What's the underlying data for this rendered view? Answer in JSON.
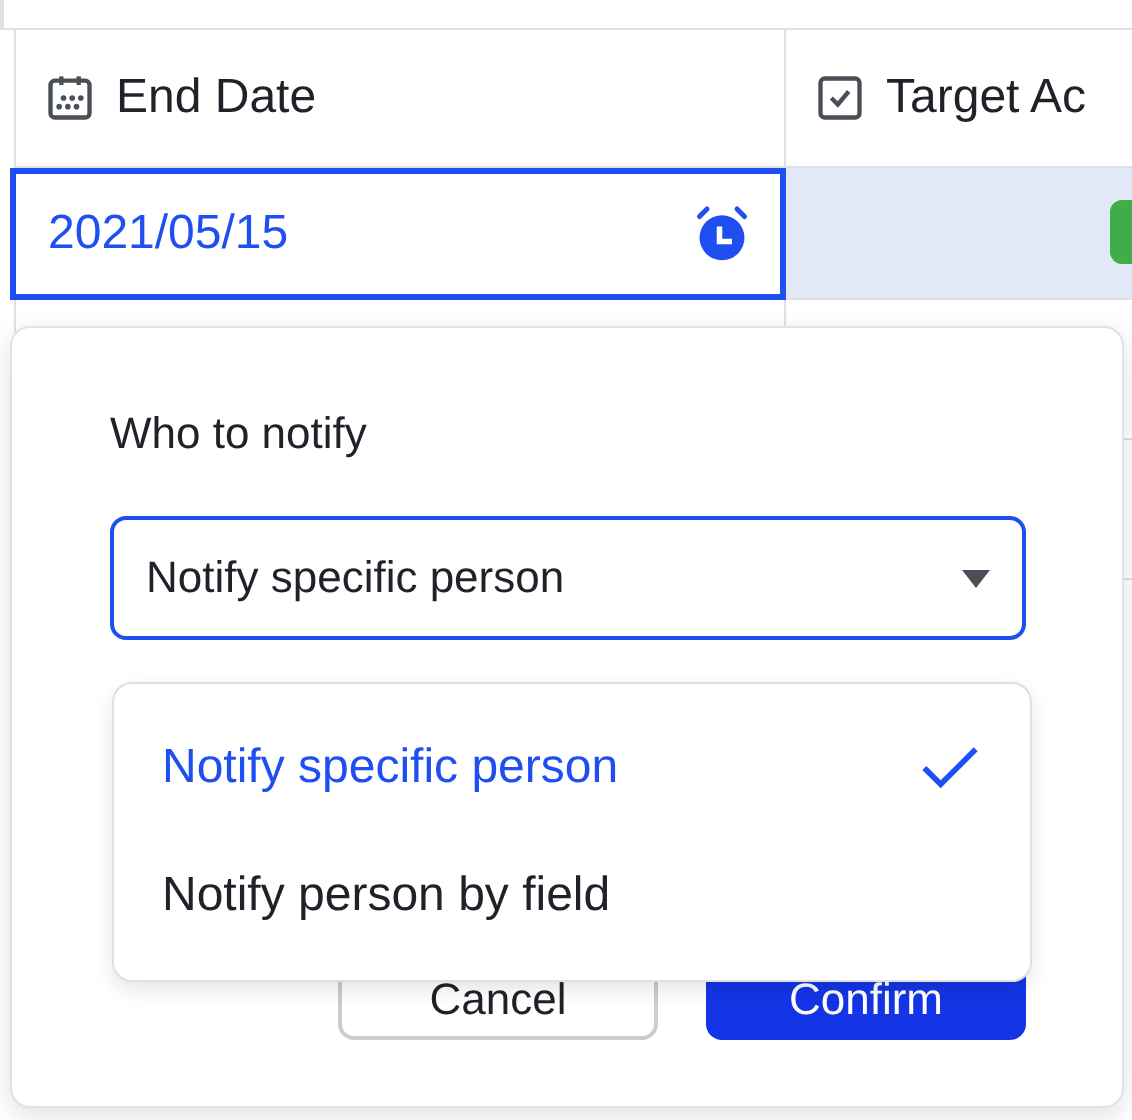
{
  "table": {
    "columns": [
      {
        "label": "End Date",
        "kind": "date"
      },
      {
        "label": "Target Ac",
        "kind": "checkbox"
      }
    ],
    "active_cell": {
      "value": "2021/05/15",
      "reminder": true
    }
  },
  "popup": {
    "label": "Who to notify",
    "select": {
      "value": "Notify specific person",
      "open": true
    },
    "options": [
      {
        "label": "Notify specific person",
        "selected": true
      },
      {
        "label": "Notify person by field",
        "selected": false
      }
    ],
    "buttons": [
      {
        "label": "Cancel",
        "kind": "secondary"
      },
      {
        "label": "Confirm",
        "kind": "primary"
      }
    ]
  }
}
